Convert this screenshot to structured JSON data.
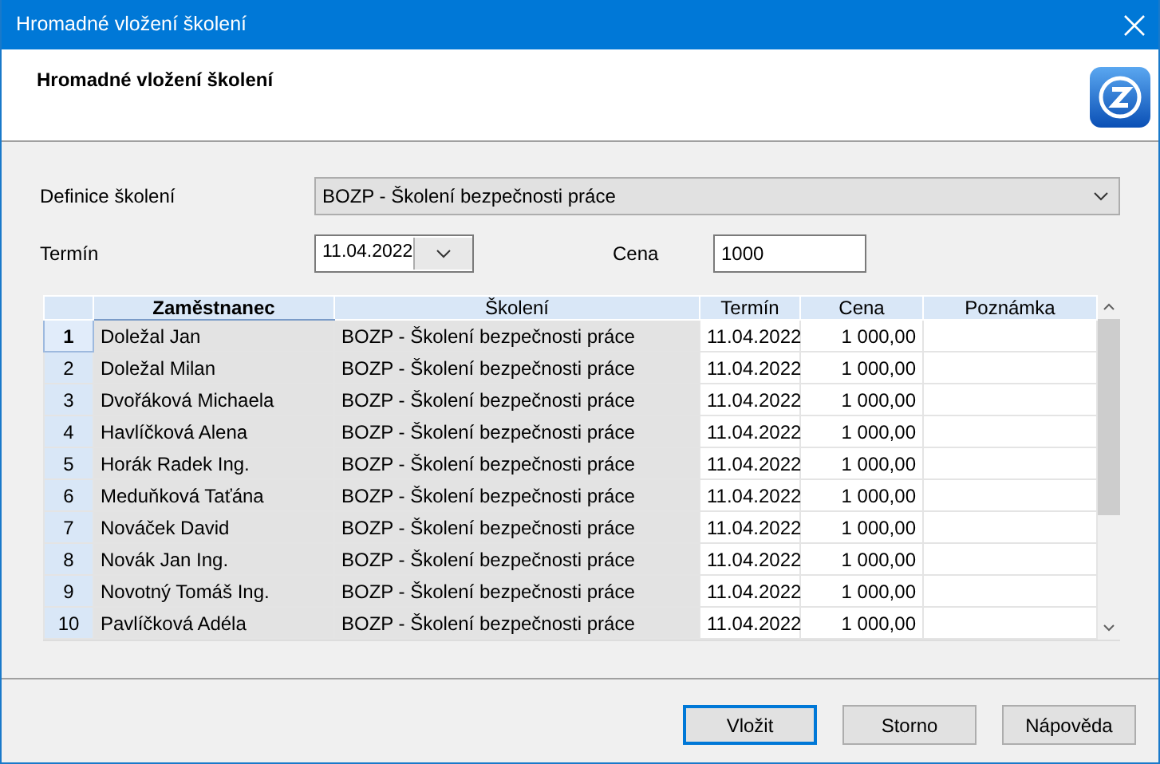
{
  "window": {
    "title": "Hromadné vložení školení"
  },
  "header": {
    "title": "Hromadné vložení školení"
  },
  "form": {
    "definition": {
      "label": "Definice školení",
      "value": "BOZP - Školení bezpečnosti práce"
    },
    "date": {
      "label": "Termín",
      "value": "11.04.2022"
    },
    "price": {
      "label": "Cena",
      "value": "1000"
    }
  },
  "table": {
    "columns": [
      {
        "label": "Zaměstnanec",
        "sorted": true
      },
      {
        "label": "Školení",
        "sorted": false
      },
      {
        "label": "Termín",
        "sorted": false
      },
      {
        "label": "Cena",
        "sorted": false
      },
      {
        "label": "Poznámka",
        "sorted": false
      }
    ],
    "rows": [
      {
        "number": "1",
        "name": "Doležal Jan",
        "training": "BOZP - Školení bezpečnosti práce",
        "date": "11.04.2022",
        "price": "1 000,00",
        "selected": true
      },
      {
        "number": "2",
        "name": "Doležal Milan",
        "training": "BOZP - Školení bezpečnosti práce",
        "date": "11.04.2022",
        "price": "1 000,00",
        "selected": false
      },
      {
        "number": "3",
        "name": "Dvořáková Michaela",
        "training": "BOZP - Školení bezpečnosti práce",
        "date": "11.04.2022",
        "price": "1 000,00",
        "selected": false
      },
      {
        "number": "4",
        "name": "Havlíčková Alena",
        "training": "BOZP - Školení bezpečnosti práce",
        "date": "11.04.2022",
        "price": "1 000,00",
        "selected": false
      },
      {
        "number": "5",
        "name": "Horák Radek Ing.",
        "training": "BOZP - Školení bezpečnosti práce",
        "date": "11.04.2022",
        "price": "1 000,00",
        "selected": false
      },
      {
        "number": "6",
        "name": "Meduňková Taťána",
        "training": "BOZP - Školení bezpečnosti práce",
        "date": "11.04.2022",
        "price": "1 000,00",
        "selected": false
      },
      {
        "number": "7",
        "name": "Nováček David",
        "training": "BOZP - Školení bezpečnosti práce",
        "date": "11.04.2022",
        "price": "1 000,00",
        "selected": false
      },
      {
        "number": "8",
        "name": "Novák Jan Ing.",
        "training": "BOZP - Školení bezpečnosti práce",
        "date": "11.04.2022",
        "price": "1 000,00",
        "selected": false
      },
      {
        "number": "9",
        "name": "Novotný Tomáš Ing.",
        "training": "BOZP - Školení bezpečnosti práce",
        "date": "11.04.2022",
        "price": "1 000,00",
        "selected": false
      },
      {
        "number": "10",
        "name": "Pavlíčková Adéla",
        "training": "BOZP - Školení bezpečnosti práce",
        "date": "11.04.2022",
        "price": "1 000,00",
        "selected": false
      }
    ]
  },
  "buttons": [
    {
      "label": "Vložit",
      "default": true
    },
    {
      "label": "Storno",
      "default": false
    },
    {
      "label": "Nápověda",
      "default": false
    }
  ]
}
